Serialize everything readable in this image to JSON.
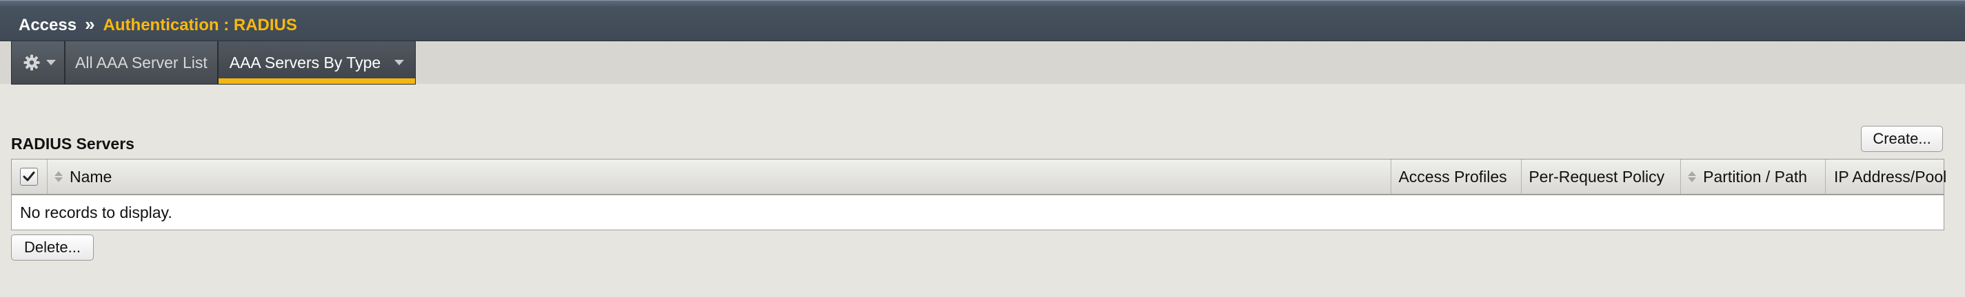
{
  "breadcrumb": {
    "root": "Access",
    "separator": "»",
    "current": "Authentication : RADIUS"
  },
  "tabs": [
    {
      "label": "",
      "icon": "gear-icon",
      "has_menu": true
    },
    {
      "label": "All AAA Server List",
      "active": false
    },
    {
      "label": "AAA Servers By Type",
      "active": true,
      "has_menu": true
    }
  ],
  "section": {
    "title": "RADIUS Servers",
    "create_label": "Create...",
    "delete_label": "Delete..."
  },
  "table": {
    "columns": [
      "Name",
      "Access Profiles",
      "Per-Request Policy",
      "Partition / Path",
      "IP Address/Pool"
    ],
    "empty_message": "No records to display."
  },
  "colors": {
    "accent": "#f3b70e",
    "breadcrumb_current": "#f9b90f",
    "titlebar": "#47525f"
  }
}
